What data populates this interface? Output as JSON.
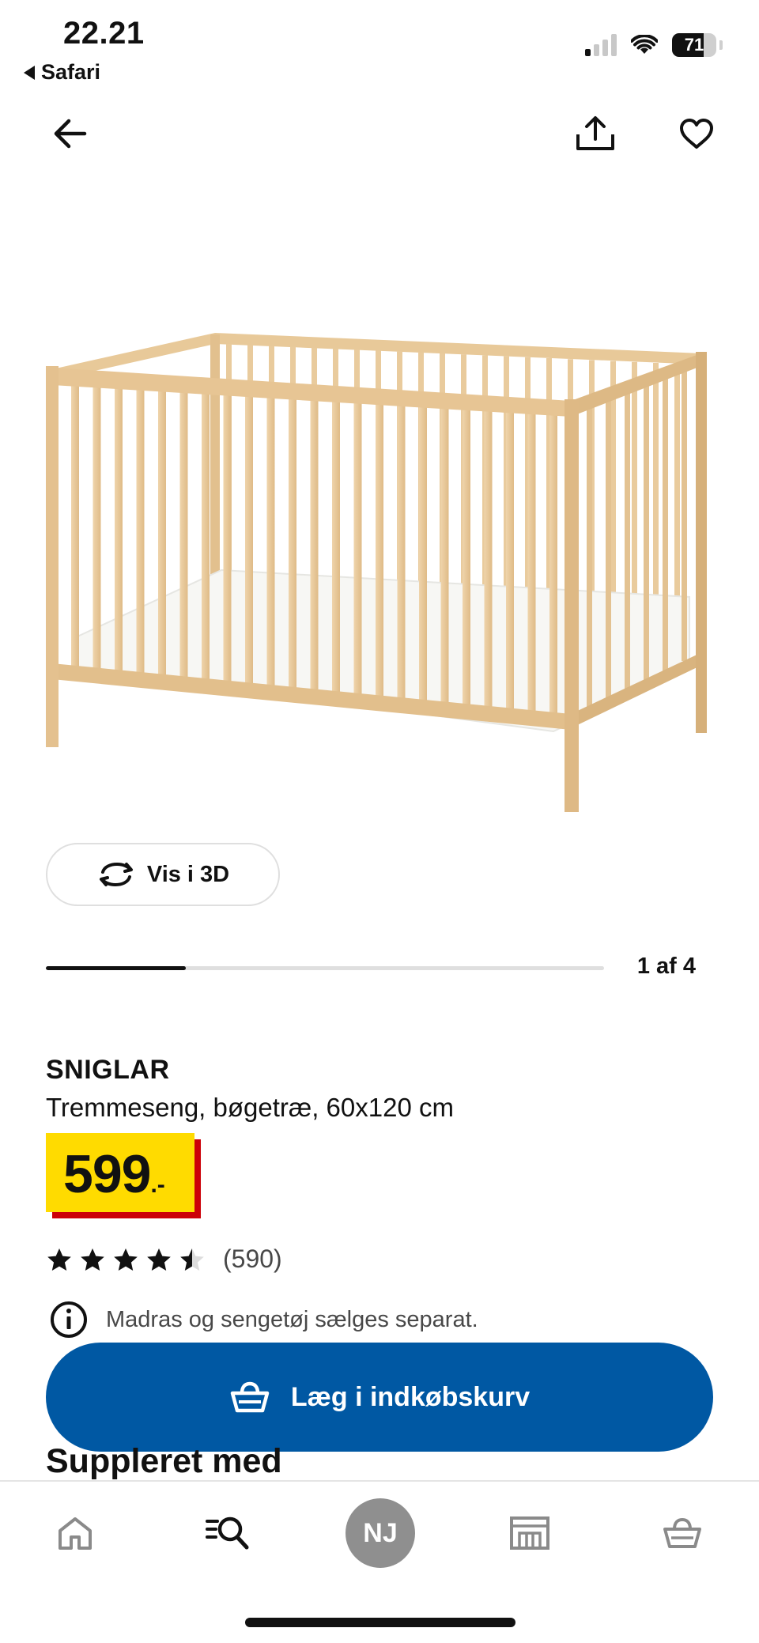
{
  "status_bar": {
    "time": "22.21",
    "back_app": "Safari",
    "battery_level": "71",
    "battery_fraction": 0.71,
    "signal_bars_active": 1
  },
  "header": {
    "back_icon": "arrow-left-icon",
    "share_icon": "share-icon",
    "favorite_icon": "heart-icon"
  },
  "gallery": {
    "view_3d_label": "Vis i 3D",
    "view_3d_icon": "rotate-3d-icon",
    "current_image": 1,
    "total_images": 4,
    "position_label": "1 af 4"
  },
  "product": {
    "name": "SNIGLAR",
    "description": "Tremmeseng, bøgetræ, 60x120 cm",
    "price_integer": "599",
    "price_suffix": ".-",
    "rating_value": 4.5,
    "rating_max": 5,
    "review_count": "(590)",
    "notice_icon": "info-icon",
    "notice_text": "Madras og sengetøj sælges separat."
  },
  "cart": {
    "add_label": "Læg i indkøbskurv",
    "icon": "basket-icon"
  },
  "section": {
    "heading": "Suppleret med"
  },
  "bottom_nav": {
    "items": [
      {
        "name": "home",
        "icon": "home-icon"
      },
      {
        "name": "search",
        "icon": "search-icon"
      },
      {
        "name": "profile",
        "initials": "NJ"
      },
      {
        "name": "stores",
        "icon": "store-icon"
      },
      {
        "name": "cart",
        "icon": "basket-icon"
      }
    ]
  },
  "colors": {
    "brand_blue": "#0058a3",
    "price_yellow": "#ffdb00",
    "price_red": "#cc0008",
    "wood": "#e7c79a",
    "avatar_gray": "#8f8f8f"
  }
}
